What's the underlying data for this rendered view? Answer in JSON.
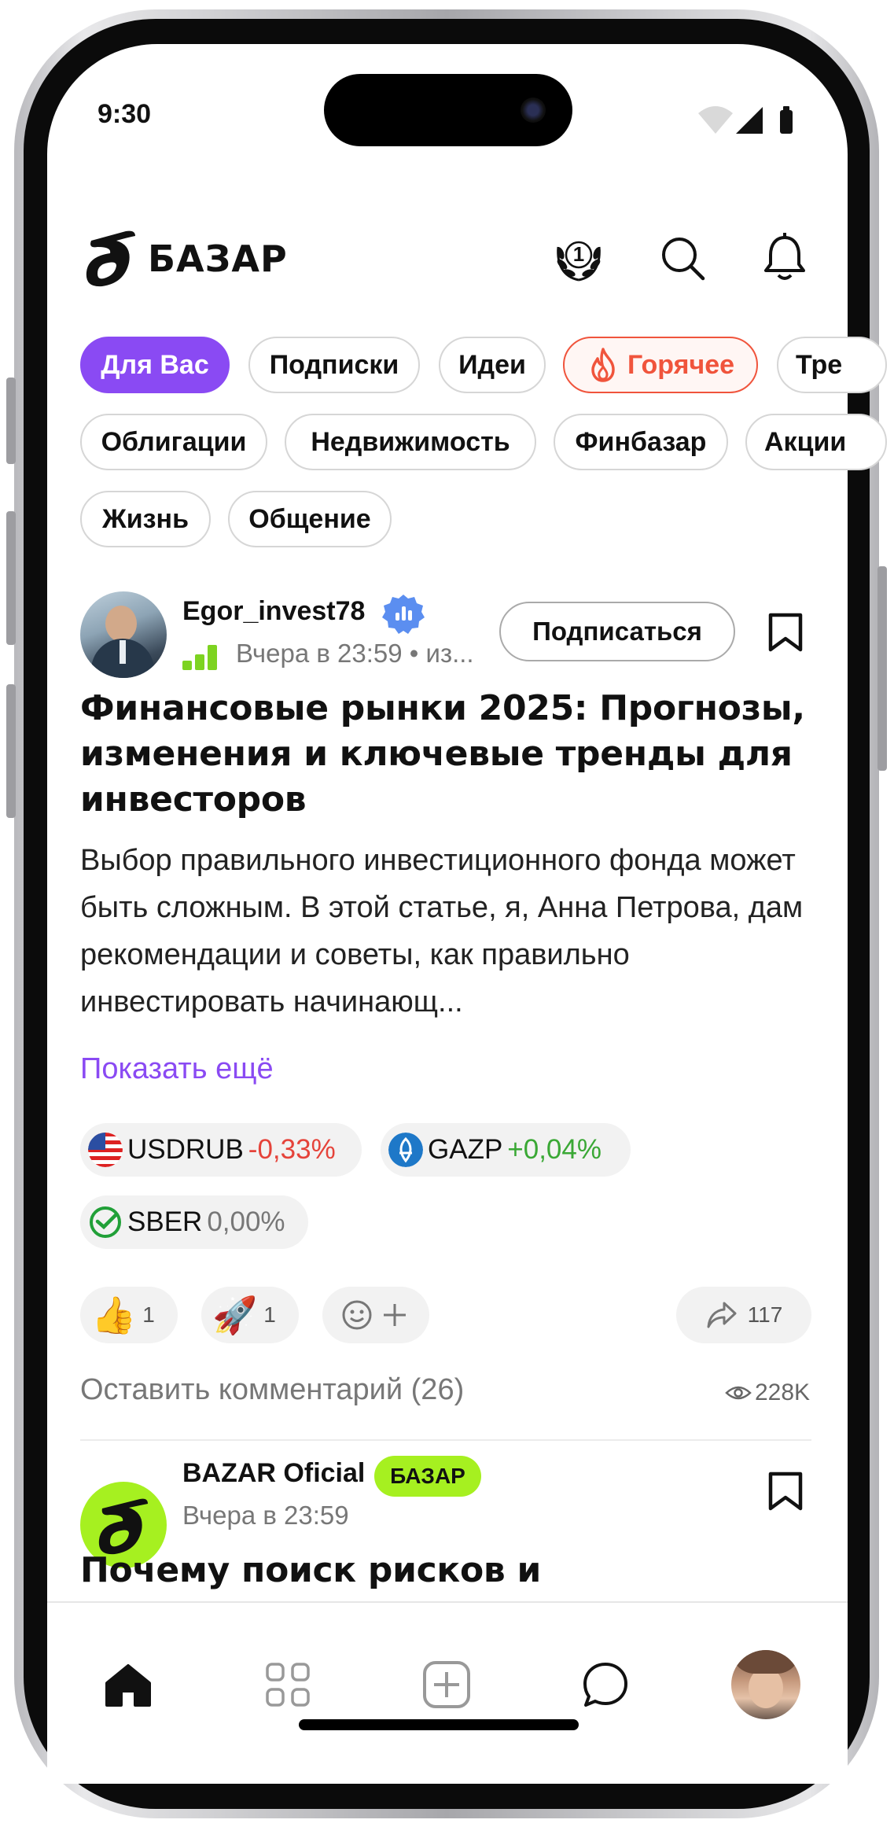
{
  "status_bar": {
    "time": "9:30"
  },
  "header": {
    "logo_text": "БАЗАР",
    "rank_badge": "1"
  },
  "chips_row1": [
    {
      "label": "Для Вас",
      "state": "active"
    },
    {
      "label": "Подписки"
    },
    {
      "label": "Идеи"
    },
    {
      "label": "Горячее",
      "state": "hot",
      "icon": "fire-icon"
    },
    {
      "label": "Тре"
    }
  ],
  "chips_row2": [
    {
      "label": "Облигации"
    },
    {
      "label": "Недвижимость"
    },
    {
      "label": "Финбазар"
    },
    {
      "label": "Акции"
    }
  ],
  "chips_row3": [
    {
      "label": "Жизнь"
    },
    {
      "label": "Общение"
    }
  ],
  "post1": {
    "author": "Egor_invest78",
    "timestamp": "Вчера в 23:59",
    "meta_suffix": "• из...",
    "subscribe_label": "Подписаться",
    "title": "Финансовые рынки 2025: Прогнозы, изменения и ключевые тренды для инвесторов",
    "body": "Выбор правильного инвестиционного фонда может быть сложным. В этой статье, я, Анна Петрова, дам рекомендации и советы, как правильно инвестировать начинающ...",
    "show_more": "Показать ещё",
    "tickers": [
      {
        "symbol": "USDRUB",
        "change": "-0,33%",
        "color": "#e5433a"
      },
      {
        "symbol": "GAZP",
        "change": "+0,04%",
        "color": "#3aa835"
      },
      {
        "symbol": "SBER",
        "change": "0,00%",
        "color": "#777777"
      }
    ],
    "reactions": [
      {
        "emoji": "👍",
        "count": "1"
      },
      {
        "emoji": "🚀",
        "count": "1"
      }
    ],
    "shares": "117",
    "comment_prompt": "Оставить комментарий (26)",
    "views": "228K"
  },
  "post2": {
    "author": "BAZAR Oficial",
    "badge": "БАЗАР",
    "timestamp": "Вчера в 23:59",
    "title": "Почему поиск рисков и"
  },
  "colors": {
    "accent": "#8a4af3",
    "hot": "#f0543c",
    "brand_lime": "#a6f020"
  }
}
